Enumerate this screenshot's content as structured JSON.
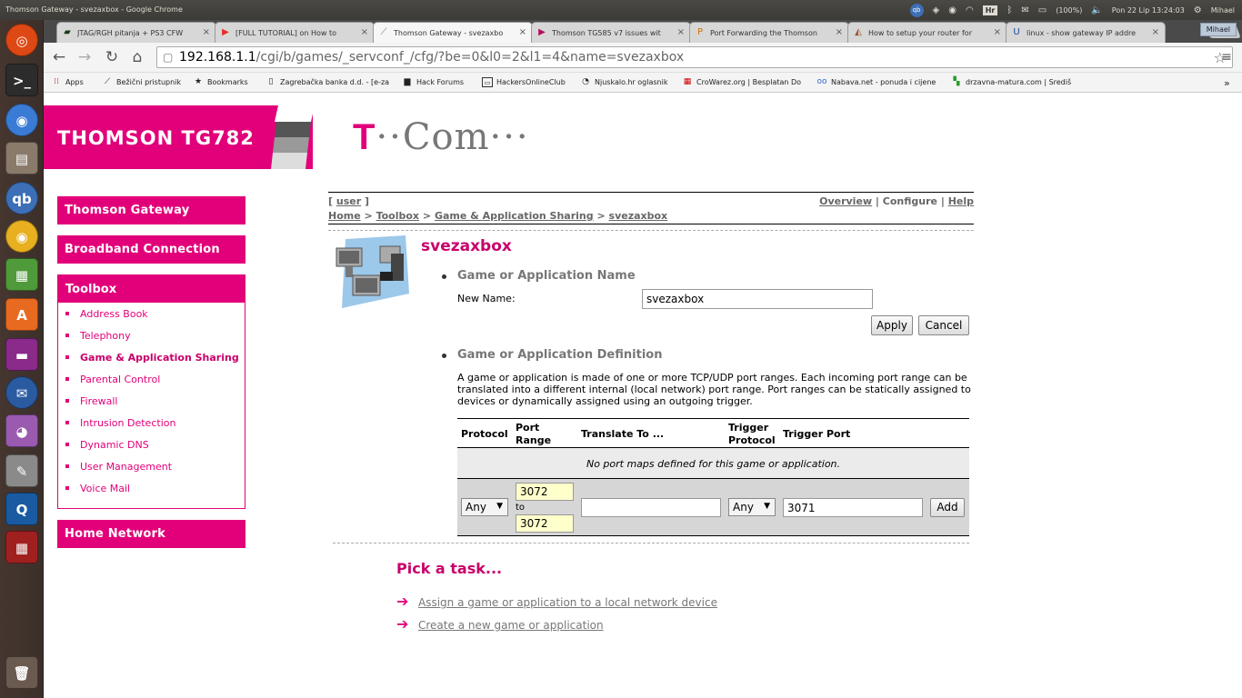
{
  "os": {
    "window_title": "Thomson Gateway - svezaxbox - Google Chrome",
    "battery": "(100%)",
    "clock": "Pon 22 Lip 13:24:03",
    "user": "Mihael",
    "keyboard": "Hr",
    "qb": "qb"
  },
  "tabs": [
    {
      "label": "JTAG/RGH pitanja + PS3 CFW",
      "icon": "jtag-icon",
      "color": "#1d3a1d"
    },
    {
      "label": "[FULL TUTORIAL] on How to",
      "icon": "youtube-icon",
      "color": "#e52d27"
    },
    {
      "label": "Thomson Gateway - svezaxbo",
      "icon": "page-icon",
      "color": "#777777"
    },
    {
      "label": "Thomson TG585 v7 issues wit",
      "icon": "ls-icon",
      "color": "#b01060"
    },
    {
      "label": "Port Forwarding the Thomson",
      "icon": "pf-icon",
      "color": "#d07010"
    },
    {
      "label": "How to setup your router for",
      "icon": "shoe-icon",
      "color": "#a0522d"
    },
    {
      "label": "linux - show gateway IP addre",
      "icon": "ul-icon",
      "color": "#1a4aa0"
    }
  ],
  "omnibox": {
    "host": "192.168.1.1",
    "path": "/cgi/b/games/_servconf_/cfg/?be=0&l0=2&l1=4&name=svezaxbox"
  },
  "bookmarks": [
    {
      "label": "Apps",
      "icon": "apps-icon"
    },
    {
      "label": "Bežični pristupnik",
      "icon": "page-icon"
    },
    {
      "label": "Bookmarks",
      "icon": "star-icon"
    },
    {
      "label": "Zagrebačka banka d.d. - [e-za",
      "icon": "page-icon"
    },
    {
      "label": "Hack Forums",
      "icon": "hackforums-icon"
    },
    {
      "label": "HackersOnlineClub",
      "icon": "hoc-icon"
    },
    {
      "label": "Njuskalo.hr oglasnik",
      "icon": "njuskalo-icon"
    },
    {
      "label": "CroWarez.org | Besplatan Do",
      "icon": "crowarez-icon"
    },
    {
      "label": "Nabava.net - ponuda i cijene",
      "icon": "nabava-icon"
    },
    {
      "label": "drzavna-matura.com | Središ",
      "icon": "matura-icon"
    }
  ],
  "brand": {
    "title": "THOMSON TG782",
    "logo_t": "T",
    "logo_dots1": "··",
    "logo_com": "Com",
    "logo_dots2": "···",
    "pink": "#e2007a"
  },
  "sidebar": {
    "thomson_gateway": "Thomson Gateway",
    "broadband": "Broadband Connection",
    "toolbox": "Toolbox",
    "toolbox_items": [
      "Address Book",
      "Telephony",
      "Game & Application Sharing",
      "Parental Control",
      "Firewall",
      "Intrusion Detection",
      "Dynamic DNS",
      "User Management",
      "Voice Mail"
    ],
    "home_network": "Home Network"
  },
  "crumbs": {
    "user_open": "[ ",
    "user": "user",
    "user_close": " ]",
    "home": "Home",
    "toolbox": "Toolbox",
    "gas": "Game & Application Sharing",
    "current": "svezaxbox",
    "sep": " > ",
    "overview": "Overview",
    "configure": "Configure",
    "help": "Help",
    "bar": " | "
  },
  "main": {
    "heading": "svezaxbox",
    "section_name": "Game or Application Name",
    "new_name_label": "New Name:",
    "new_name_value": "svezaxbox",
    "apply": "Apply",
    "cancel": "Cancel",
    "section_def": "Game or Application Definition",
    "description": "A game or application is made of one or more TCP/UDP port ranges. Each incoming port range can be translated into a different internal (local network) port range. Port ranges can be statically assigned to devices or dynamically assigned using an outgoing trigger."
  },
  "port_table": {
    "headers": {
      "protocol": "Protocol",
      "port_range_1": "Port",
      "port_range_2": "Range",
      "translate": "Translate To ...",
      "trigger_proto_1": "Trigger",
      "trigger_proto_2": "Protocol",
      "trigger_port": "Trigger Port"
    },
    "empty": "No port maps defined for this game or application.",
    "row": {
      "protocol": "Any",
      "port_from": "3072",
      "to": "to",
      "port_to": "3072",
      "translate": "",
      "trigger_protocol": "Any",
      "trigger_port": "3071",
      "add": "Add"
    }
  },
  "tasks": {
    "title": "Pick a task...",
    "items": [
      "Assign a game or application to a local network device",
      "Create a new game or application"
    ]
  }
}
